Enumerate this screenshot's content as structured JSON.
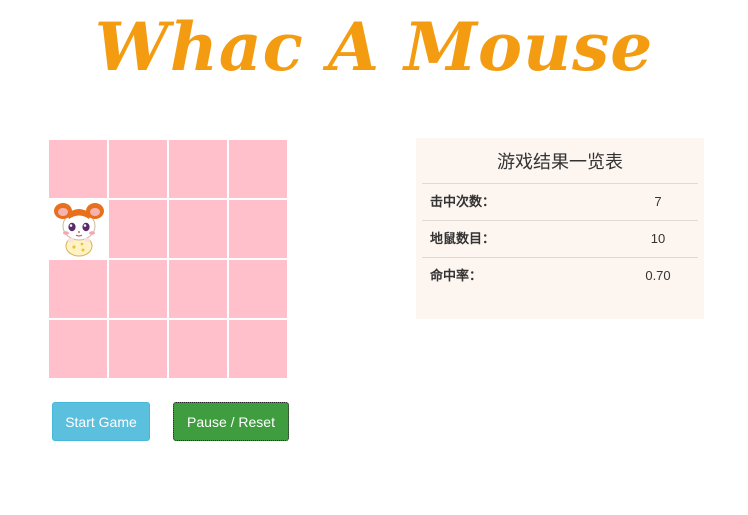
{
  "title": "Whac A Mouse",
  "board": {
    "rows": 4,
    "cols": 4,
    "cell_color": "#ffc0cb",
    "active_cell": {
      "row": 1,
      "col": 0
    }
  },
  "buttons": {
    "start_label": "Start Game",
    "pause_label": "Pause / Reset"
  },
  "results": {
    "title": "游戏结果一览表",
    "rows": [
      {
        "label": "击中次数：",
        "value": "7"
      },
      {
        "label": "地鼠数目：",
        "value": "10"
      },
      {
        "label": "命中率：",
        "value": "0.70"
      }
    ]
  },
  "colors": {
    "title": "#f39c12",
    "start_button": "#5bc0de",
    "pause_button": "#3f9c3f",
    "panel_bg": "#fdf5f0"
  }
}
